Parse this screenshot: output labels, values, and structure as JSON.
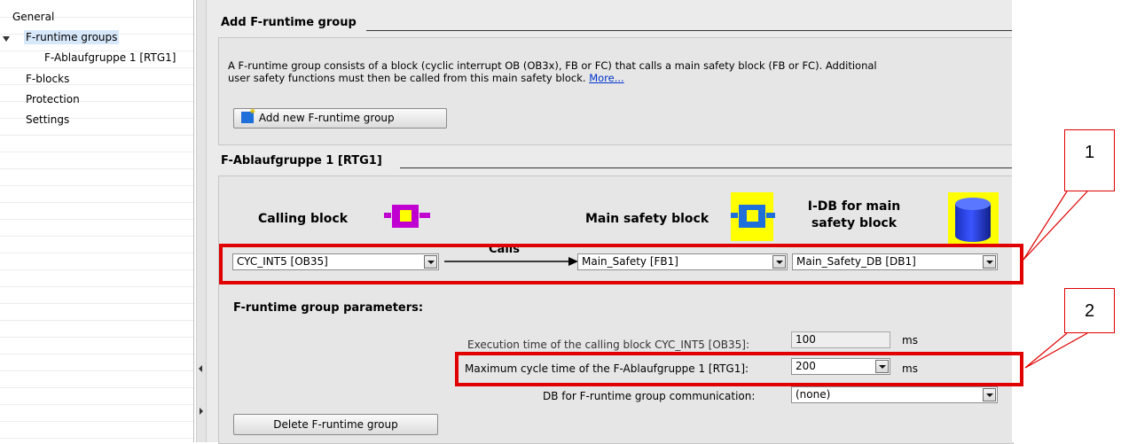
{
  "tree": {
    "items": [
      {
        "label": "General"
      },
      {
        "label": "F-runtime groups"
      },
      {
        "label": "F-Ablaufgruppe 1 [RTG1]"
      },
      {
        "label": "F-blocks"
      },
      {
        "label": "Protection"
      },
      {
        "label": "Settings"
      }
    ]
  },
  "add_group": {
    "title": "Add F-runtime group",
    "description_line1": "A F-runtime group consists of a block (cyclic interrupt OB (OB3x), FB or FC) that calls a main safety block (FB or FC). Additional",
    "description_line2": "user safety functions must then be called from this main safety block.",
    "more_link": "More...",
    "add_button": "Add new F-runtime group"
  },
  "group": {
    "title": "F-Ablaufgruppe 1 [RTG1]",
    "calling_block_header": "Calling block",
    "main_safety_header": "Main safety block",
    "idb_header_line1": "I-DB for main",
    "idb_header_line2": "safety block",
    "calls_label": "Calls",
    "calling_block_value": "CYC_INT5 [OB35]",
    "main_safety_value": "Main_Safety [FB1]",
    "idb_value": "Main_Safety_DB [DB1]",
    "params_title": "F-runtime group parameters:",
    "exec_time_label": "Execution time of the calling block CYC_INT5 [OB35]:",
    "exec_time_value": "100",
    "exec_time_unit": "ms",
    "max_cycle_label": "Maximum cycle time of the F-Ablaufgruppe 1 [RTG1]:",
    "max_cycle_value": "200",
    "max_cycle_unit": "ms",
    "db_comm_label": "DB for F-runtime group communication:",
    "db_comm_value": "(none)",
    "delete_button": "Delete F-runtime group"
  },
  "callouts": {
    "one": "1",
    "two": "2"
  },
  "colors": {
    "highlight_red": "#e00000",
    "icon_yellow": "#ffff00",
    "fb_icon_blue": "#1e6fd9",
    "ob_icon_purple": "#c000d0"
  }
}
